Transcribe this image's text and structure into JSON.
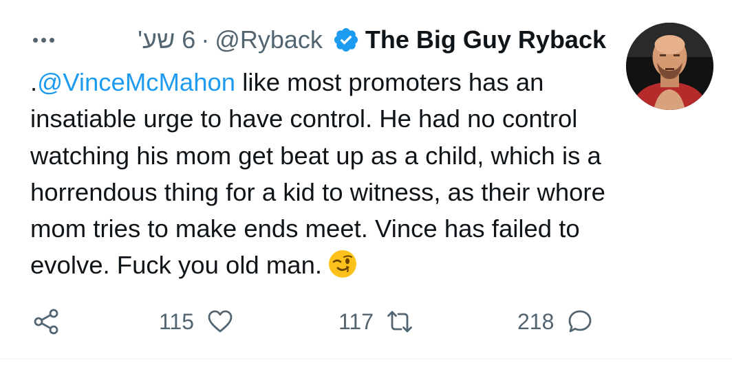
{
  "tweet": {
    "author_name": "The Big Guy Ryback",
    "handle": "@Ryback",
    "separator": "·",
    "time": "6 שע'",
    "verified": true,
    "text_prefix": ".",
    "mention": "@VinceMcMahon",
    "text_body": " like most promoters has an insatiable urge to have control. He had no control watching his mom get beat up as a child, which is a horrendous thing for a kid to witness, as their whore mom tries to make ends meet. Vince has failed to evolve. Fuck you old man.",
    "emoji": "winking-face"
  },
  "actions": {
    "likes": "115",
    "retweets": "117",
    "replies": "218"
  },
  "colors": {
    "accent": "#1d9bf0",
    "muted": "#536471",
    "text": "#0f1419"
  }
}
